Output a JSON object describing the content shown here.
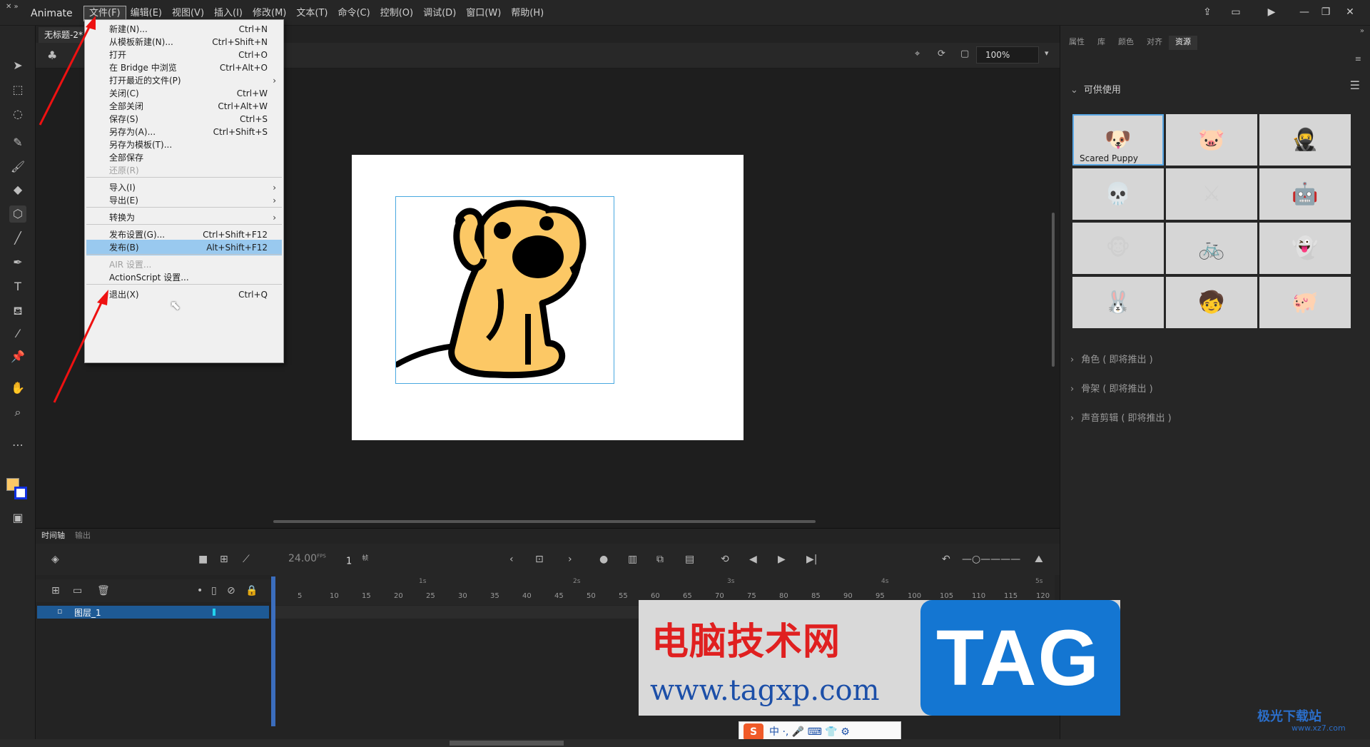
{
  "app": {
    "name": "Animate",
    "doc_tab": "无标题-2*",
    "menus": [
      "文件(F)",
      "编辑(E)",
      "视图(V)",
      "插入(I)",
      "修改(M)",
      "文本(T)",
      "命令(C)",
      "控制(O)",
      "调试(D)",
      "窗口(W)",
      "帮助(H)"
    ],
    "zoom": "100%"
  },
  "file_menu": {
    "groups": [
      [
        {
          "label": "新建(N)...",
          "shortcut": "Ctrl+N"
        },
        {
          "label": "从模板新建(N)...",
          "shortcut": "Ctrl+Shift+N"
        },
        {
          "label": "打开",
          "shortcut": "Ctrl+O"
        },
        {
          "label": "在 Bridge 中浏览",
          "shortcut": "Ctrl+Alt+O"
        },
        {
          "label": "打开最近的文件(P)",
          "shortcut": "",
          "submenu": true
        },
        {
          "label": "关闭(C)",
          "shortcut": "Ctrl+W"
        },
        {
          "label": "全部关闭",
          "shortcut": "Ctrl+Alt+W"
        },
        {
          "label": "保存(S)",
          "shortcut": "Ctrl+S"
        },
        {
          "label": "另存为(A)...",
          "shortcut": "Ctrl+Shift+S"
        },
        {
          "label": "另存为模板(T)...",
          "shortcut": ""
        },
        {
          "label": "全部保存",
          "shortcut": ""
        },
        {
          "label": "还原(R)",
          "shortcut": "",
          "disabled": true
        }
      ],
      [
        {
          "label": "导入(I)",
          "shortcut": "",
          "submenu": true
        },
        {
          "label": "导出(E)",
          "shortcut": "",
          "submenu": true
        }
      ],
      [
        {
          "label": "转换为",
          "shortcut": "",
          "submenu": true
        }
      ],
      [
        {
          "label": "发布设置(G)...",
          "shortcut": "Ctrl+Shift+F12"
        },
        {
          "label": "发布(B)",
          "shortcut": "Alt+Shift+F12",
          "highlighted": true
        }
      ],
      [
        {
          "label": "AIR 设置...",
          "shortcut": "",
          "disabled": true
        },
        {
          "label": "ActionScript 设置...",
          "shortcut": ""
        }
      ],
      [
        {
          "label": "退出(X)",
          "shortcut": "Ctrl+Q"
        }
      ]
    ]
  },
  "right_panel": {
    "tabs": [
      "属性",
      "库",
      "颜色",
      "对齐",
      "资源"
    ],
    "active_tab": "资源",
    "available_header": "可供使用",
    "assets": [
      {
        "caption": "Scared Puppy",
        "icon": "puppy"
      },
      {
        "caption": "",
        "icon": "pig-parachute"
      },
      {
        "caption": "",
        "icon": "ninja"
      },
      {
        "caption": "",
        "icon": "skeleton"
      },
      {
        "caption": "",
        "icon": "warrior"
      },
      {
        "caption": "",
        "icon": "robot"
      },
      {
        "caption": "",
        "icon": "monkey"
      },
      {
        "caption": "",
        "icon": "cyclist"
      },
      {
        "caption": "",
        "icon": "ghost"
      },
      {
        "caption": "",
        "icon": "rabbit"
      },
      {
        "caption": "",
        "icon": "boy"
      },
      {
        "caption": "",
        "icon": "pink-pig"
      }
    ],
    "sections": [
      "角色 ( 即将推出 )",
      "骨架 ( 即将推出 )",
      "声音剪辑 ( 即将推出 )"
    ]
  },
  "timeline": {
    "tabs": [
      "时间轴",
      "输出"
    ],
    "fps": "24.00",
    "fps_unit": "FPS",
    "frame": "1",
    "frame_unit": "帧",
    "layer_name": "图层_1",
    "ruler_numbers": [
      "5",
      "10",
      "15",
      "20",
      "25",
      "30",
      "35",
      "40",
      "45",
      "50",
      "55",
      "60",
      "65",
      "70",
      "75",
      "80",
      "85",
      "90",
      "95",
      "100",
      "105",
      "110",
      "115",
      "120"
    ],
    "ruler_seconds": [
      "1s",
      "2s",
      "3s",
      "4s",
      "5s"
    ]
  },
  "watermark": {
    "cn": "电脑技术网",
    "url": "www.tagxp.com",
    "tag": "TAG",
    "site2": "极光下载站",
    "site2_url": "www.xz7.com"
  },
  "ime": {
    "logo": "S",
    "text": "中 ·, 🎤 ⌨ 👕 ⚙"
  },
  "colors": {
    "accent": "#1e5a95",
    "highlight": "#99c9ef",
    "selection": "#49a8e0",
    "puppy": "#fcc865"
  }
}
